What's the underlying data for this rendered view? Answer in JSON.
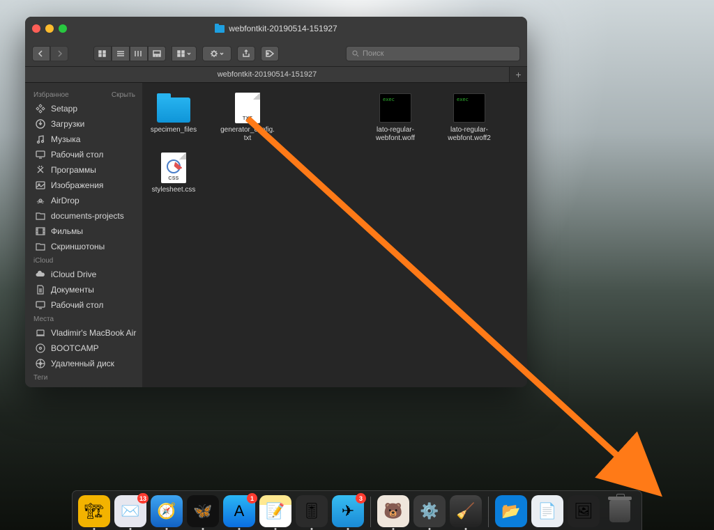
{
  "window": {
    "title": "webfontkit-20190514-151927",
    "tab_title": "webfontkit-20190514-151927",
    "search_placeholder": "Поиск"
  },
  "sidebar": {
    "favorites_header": "Избранное",
    "hide_label": "Скрыть",
    "icloud_header": "iCloud",
    "places_header": "Места",
    "tags_header": "Теги",
    "favorites": [
      {
        "label": "Setapp",
        "icon": "setapp"
      },
      {
        "label": "Загрузки",
        "icon": "downloads"
      },
      {
        "label": "Музыка",
        "icon": "music"
      },
      {
        "label": "Рабочий стол",
        "icon": "desktop"
      },
      {
        "label": "Программы",
        "icon": "apps"
      },
      {
        "label": "Изображения",
        "icon": "images"
      },
      {
        "label": "AirDrop",
        "icon": "airdrop"
      },
      {
        "label": "documents-projects",
        "icon": "folder"
      },
      {
        "label": "Фильмы",
        "icon": "movies"
      },
      {
        "label": "Скриншотоны",
        "icon": "folder"
      }
    ],
    "icloud": [
      {
        "label": "iCloud Drive",
        "icon": "icloud"
      },
      {
        "label": "Документы",
        "icon": "docs"
      },
      {
        "label": "Рабочий стол",
        "icon": "desktop"
      }
    ],
    "places": [
      {
        "label": "Vladimir's MacBook Air",
        "icon": "laptop"
      },
      {
        "label": "BOOTCAMP",
        "icon": "disk"
      },
      {
        "label": "Удаленный диск",
        "icon": "remote"
      }
    ]
  },
  "files": [
    {
      "name": "specimen_files",
      "type": "folder"
    },
    {
      "name": "generator_config.txt",
      "type": "txt"
    },
    {
      "name": "lato-regular-webfont.woff",
      "type": "exec"
    },
    {
      "name": "lato-regular-webfont.woff2",
      "type": "exec"
    },
    {
      "name": "stylesheet.css",
      "type": "css"
    }
  ],
  "dock": {
    "apps": [
      {
        "name": "forklift",
        "bg": "#f3b300",
        "emoji": "🏗"
      },
      {
        "name": "mail",
        "bg": "#e7e7ef",
        "emoji": "✉️",
        "badge": "13"
      },
      {
        "name": "safari",
        "bg": "linear-gradient(#3ea4f0,#1262c4)",
        "emoji": "🧭"
      },
      {
        "name": "butterfly",
        "bg": "#111",
        "emoji": "🦋"
      },
      {
        "name": "appstore",
        "bg": "linear-gradient(#2ab7f5,#0b6ee0)",
        "emoji": "A",
        "badge": "1"
      },
      {
        "name": "notes",
        "bg": "linear-gradient(#ffe890 0 30%,#fff 30%)",
        "emoji": "📝"
      },
      {
        "name": "logic",
        "bg": "#2b2b2b",
        "emoji": "🎚"
      },
      {
        "name": "telegram",
        "bg": "linear-gradient(#37bdf1,#1a8ad6)",
        "emoji": "✈",
        "badge": "3"
      }
    ],
    "right": [
      {
        "name": "bear",
        "bg": "#efe6dc",
        "emoji": "🐻"
      },
      {
        "name": "settings",
        "bg": "#3a3a3a",
        "emoji": "⚙️"
      },
      {
        "name": "cleaner",
        "bg": "linear-gradient(#434343,#222)",
        "emoji": "🧹"
      }
    ],
    "files": [
      {
        "name": "dropbox",
        "bg": "#0a7edb",
        "emoji": "📂"
      },
      {
        "name": "pdf",
        "bg": "#eaeef3",
        "emoji": "📄"
      },
      {
        "name": "image",
        "bg": "#222",
        "emoji": "🖼"
      },
      {
        "name": "trash",
        "bg": "transparent",
        "emoji": ""
      }
    ]
  },
  "annotation": {
    "arrow_color": "#ff7a17"
  }
}
